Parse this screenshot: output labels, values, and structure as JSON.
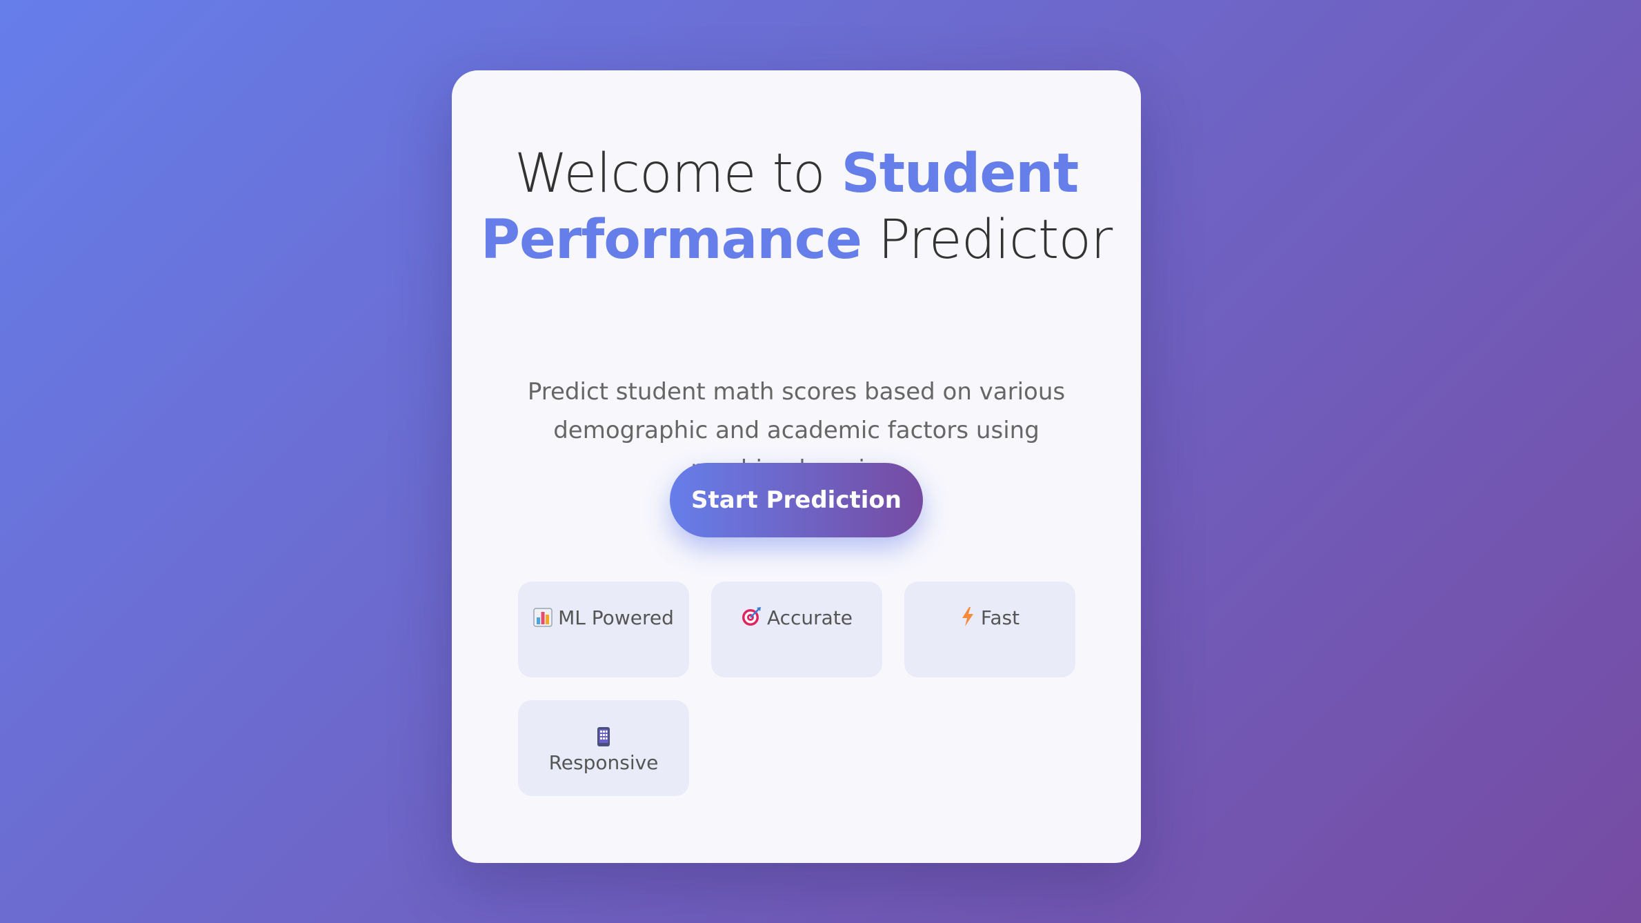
{
  "hero": {
    "title_prefix": "Welcome to ",
    "title_accent": "Student Performance",
    "title_suffix": " Predictor",
    "subtitle": "Predict student math scores based on various demographic and academic factors using machine learning.",
    "cta_label": "Start Prediction"
  },
  "features": [
    {
      "icon": "bar-chart-icon",
      "label": "ML Powered"
    },
    {
      "icon": "target-icon",
      "label": "Accurate"
    },
    {
      "icon": "lightning-icon",
      "label": "Fast"
    },
    {
      "icon": "mobile-phone-icon",
      "label": "Responsive"
    }
  ],
  "colors": {
    "accent": "#667eea",
    "gradient_start": "#667eea",
    "gradient_end": "#764ba2",
    "card_background": "#f7f7fc",
    "feature_background": "#e9ebf8"
  }
}
